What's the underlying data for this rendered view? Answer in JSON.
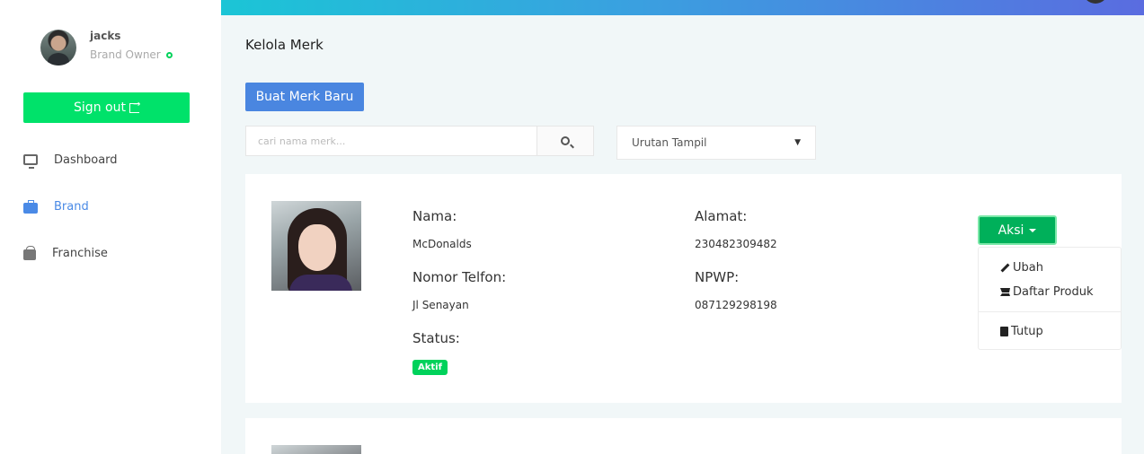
{
  "user": {
    "name": "jacks",
    "role": "Brand Owner"
  },
  "sidebar": {
    "signout_label": "Sign out",
    "items": [
      {
        "label": "Dashboard",
        "icon": "monitor-icon",
        "active": false
      },
      {
        "label": "Brand",
        "icon": "briefcase-icon",
        "active": true
      },
      {
        "label": "Franchise",
        "icon": "shopping-bag-icon",
        "active": false
      }
    ]
  },
  "main": {
    "title": "Kelola Merk",
    "new_button": "Buat Merk Baru",
    "search_placeholder": "cari nama merk...",
    "sort_select": "Urutan Tampil"
  },
  "brand_card": {
    "nama_label": "Nama:",
    "nama_value": "McDonalds",
    "alamat_label": "Alamat:",
    "alamat_value": "230482309482",
    "telfon_label": "Nomor Telfon:",
    "telfon_value": "Jl Senayan",
    "npwp_label": "NPWP:",
    "npwp_value": "087129298198",
    "status_label": "Status:",
    "status_value": "Aktif",
    "action_button": "Aksi"
  },
  "action_menu": {
    "items": [
      "Ubah",
      "Daftar Produk",
      "Tutup"
    ]
  },
  "colors": {
    "accent_blue": "#4a86e0",
    "signout_green": "#00e26a",
    "action_green": "#00b05a",
    "header_gradient": [
      "#1bc5d6",
      "#5a6ce0"
    ]
  }
}
